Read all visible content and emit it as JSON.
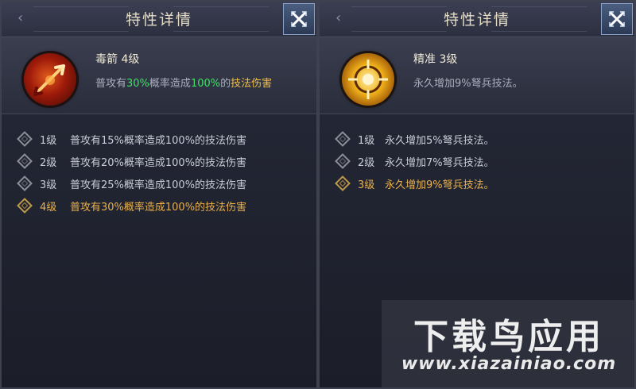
{
  "panels": [
    {
      "title": "特性详情",
      "skill": {
        "name": "毒箭 4级",
        "desc_prefix": "普攻有",
        "desc_pct1": "30%",
        "desc_mid": "概率造成",
        "desc_pct2": "100%",
        "desc_of": "的",
        "desc_suffix": "技法伤害",
        "icon": "poison-arrow-icon"
      },
      "levels": [
        {
          "label": "1级",
          "text": "普攻有15%概率造成100%的技法伤害"
        },
        {
          "label": "2级",
          "text": "普攻有20%概率造成100%的技法伤害"
        },
        {
          "label": "3级",
          "text": "普攻有25%概率造成100%的技法伤害"
        },
        {
          "label": "4级",
          "text": "普攻有30%概率造成100%的技法伤害",
          "active": true
        }
      ]
    },
    {
      "title": "特性详情",
      "skill": {
        "name": "精准 3级",
        "desc": "永久增加9%弩兵技法。",
        "icon": "precision-target-icon"
      },
      "levels": [
        {
          "label": "1级",
          "text": "永久增加5%弩兵技法。"
        },
        {
          "label": "2级",
          "text": "永久增加7%弩兵技法。"
        },
        {
          "label": "3级",
          "text": "永久增加9%弩兵技法。",
          "active": true
        }
      ]
    }
  ],
  "watermark": {
    "main": "下载鸟应用",
    "url": "www.xiazainiao.com"
  },
  "colors": {
    "highlight_green": "#3fe06a",
    "highlight_gold": "#f0c04a",
    "active_level": "#e8b04e"
  }
}
